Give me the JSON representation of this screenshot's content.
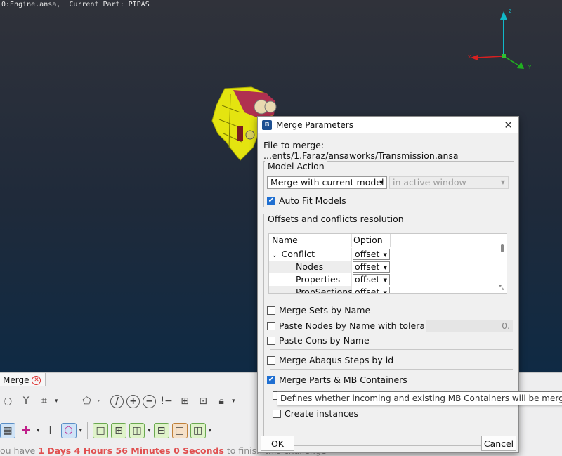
{
  "viewport": {
    "title_line": "0:Engine.ansa,  Current Part: PIPAS"
  },
  "triad": {
    "z": "Z",
    "x": "X",
    "y": "Y"
  },
  "bottom": {
    "tab_label": "Merge",
    "challenge_prefix": "ou have ",
    "challenge_time": "1 Days 4 Hours 56 Minutes 0 Seconds",
    "challenge_suffix": " to finish this challenge"
  },
  "dialog": {
    "title": "Merge Parameters",
    "file_label": "File to merge:",
    "file_path": "...ents/1.Faraz/ansaworks/Transmission.ansa",
    "model_action": {
      "title": "Model Action",
      "merge_select": "Merge with current model",
      "window_select": "in active window",
      "auto_fit": {
        "label": "Auto Fit Models",
        "checked": true
      }
    },
    "offsets": {
      "title": "Offsets and conflicts resolution",
      "columns": [
        "Name",
        "Option"
      ],
      "rows": [
        {
          "name": "Conflict resolution",
          "option": "offset",
          "expander": "⌄"
        },
        {
          "name": "Nodes",
          "option": "offset"
        },
        {
          "name": "Properties",
          "option": "offset"
        },
        {
          "name": "PropSections",
          "option": "offset"
        }
      ],
      "merge_sets": "Merge Sets by Name",
      "paste_nodes": "Paste Nodes by Name with tolerance",
      "tolerance": "0.",
      "paste_cons": "Paste Cons by Name",
      "merge_abaqus": "Merge Abaqus Steps by id",
      "merge_parts": "Merge Parts & MB Containers",
      "create_instances": "Create instances"
    },
    "tooltip": "Defines whether incoming and existing MB Containers will be merged.",
    "ok": "OK",
    "cancel": "Cancel"
  }
}
